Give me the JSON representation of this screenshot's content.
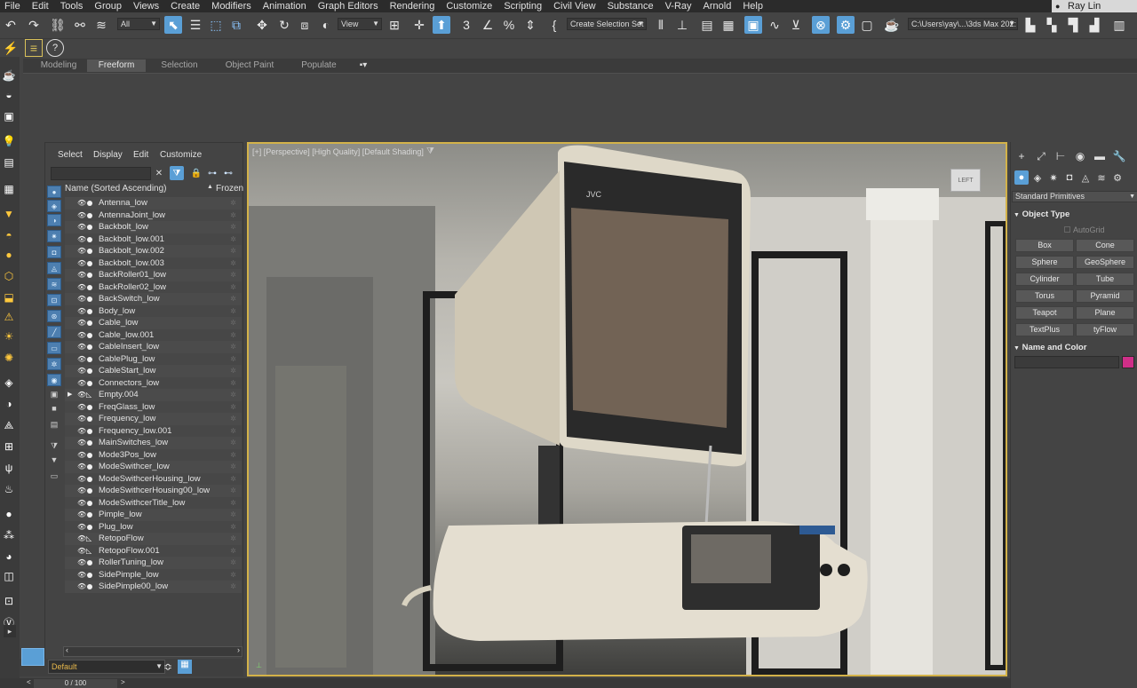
{
  "menu": {
    "items": [
      "File",
      "Edit",
      "Tools",
      "Group",
      "Views",
      "Create",
      "Modifiers",
      "Animation",
      "Graph Editors",
      "Rendering",
      "Customize",
      "Scripting",
      "Civil View",
      "Substance",
      "V-Ray",
      "Arnold",
      "Help"
    ],
    "user": "Ray Lin"
  },
  "toolbar": {
    "selection_filter": "All",
    "ref_coord": "View",
    "named_selection": "Create Selection Set",
    "project_path": "C:\\Users\\yay\\...\\3ds Max 202:"
  },
  "ribbon": {
    "tabs": [
      "Modeling",
      "Freeform",
      "Selection",
      "Object Paint",
      "Populate"
    ],
    "active_tab": "Freeform"
  },
  "scene_explorer": {
    "menus": [
      "Select",
      "Display",
      "Edit",
      "Customize"
    ],
    "column_name": "Name (Sorted Ascending)",
    "column_frozen": "Frozen",
    "objects": [
      {
        "name": "Antenna_low",
        "type": "geo"
      },
      {
        "name": "AntennaJoint_low",
        "type": "geo"
      },
      {
        "name": "Backbolt_low",
        "type": "geo"
      },
      {
        "name": "Backbolt_low.001",
        "type": "geo"
      },
      {
        "name": "Backbolt_low.002",
        "type": "geo"
      },
      {
        "name": "Backbolt_low.003",
        "type": "geo"
      },
      {
        "name": "BackRoller01_low",
        "type": "geo"
      },
      {
        "name": "BackRoller02_low",
        "type": "geo"
      },
      {
        "name": "BackSwitch_low",
        "type": "geo"
      },
      {
        "name": "Body_low",
        "type": "geo"
      },
      {
        "name": "Cable_low",
        "type": "geo"
      },
      {
        "name": "Cable_low.001",
        "type": "geo"
      },
      {
        "name": "CableInsert_low",
        "type": "geo"
      },
      {
        "name": "CablePlug_low",
        "type": "geo"
      },
      {
        "name": "CableStart_low",
        "type": "geo"
      },
      {
        "name": "Connectors_low",
        "type": "geo"
      },
      {
        "name": "Empty.004",
        "type": "bone",
        "expandable": true
      },
      {
        "name": "FreqGlass_low",
        "type": "geo"
      },
      {
        "name": "Frequency_low",
        "type": "geo"
      },
      {
        "name": "Frequency_low.001",
        "type": "geo"
      },
      {
        "name": "MainSwitches_low",
        "type": "geo"
      },
      {
        "name": "Mode3Pos_low",
        "type": "geo"
      },
      {
        "name": "ModeSwithcer_low",
        "type": "geo"
      },
      {
        "name": "ModeSwithcerHousing_low",
        "type": "geo"
      },
      {
        "name": "ModeSwithcerHousing00_low",
        "type": "geo"
      },
      {
        "name": "ModeSwithcerTitle_low",
        "type": "geo"
      },
      {
        "name": "Pimple_low",
        "type": "geo"
      },
      {
        "name": "Plug_low",
        "type": "geo"
      },
      {
        "name": "RetopoFlow",
        "type": "bone"
      },
      {
        "name": "RetopoFlow.001",
        "type": "bone"
      },
      {
        "name": "RollerTuning_low",
        "type": "geo"
      },
      {
        "name": "SidePimple_low",
        "type": "geo"
      },
      {
        "name": "SidePimple00_low",
        "type": "geo"
      }
    ]
  },
  "layer": {
    "current": "Default"
  },
  "timeline": {
    "frame_display": "0 / 100"
  },
  "viewport": {
    "label": "[+] [Perspective] [High Quality] [Default Shading]",
    "brand_text": "JVC"
  },
  "command_panel": {
    "category": "Standard Primitives",
    "object_type_title": "Object Type",
    "autogrid": "AutoGrid",
    "buttons": [
      "Box",
      "Cone",
      "Sphere",
      "GeoSphere",
      "Cylinder",
      "Tube",
      "Torus",
      "Pyramid",
      "Teapot",
      "Plane",
      "TextPlus",
      "tyFlow"
    ],
    "name_color_title": "Name and Color",
    "object_color": "#cf2f88"
  },
  "colors": {
    "accent": "#5a9fd6",
    "viewport_border": "#d3b249",
    "layer_text": "#e8b84b"
  }
}
